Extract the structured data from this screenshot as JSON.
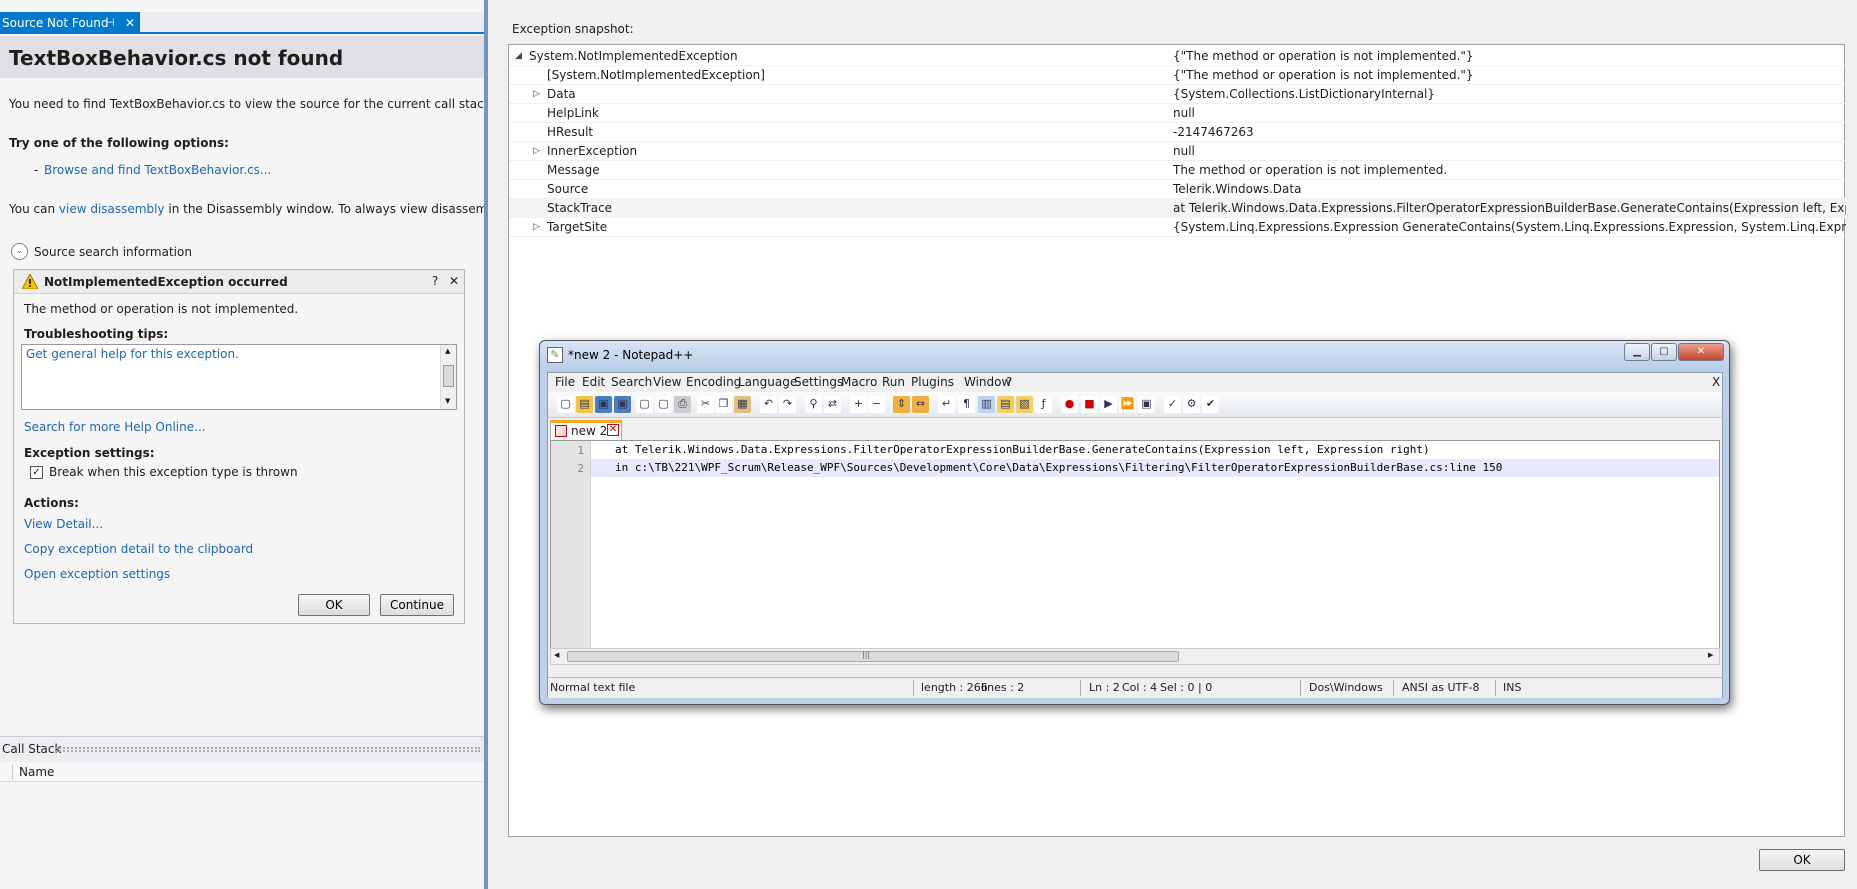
{
  "source_panel": {
    "tab_label": "Source Not Found",
    "pin_glyph": "⊣",
    "close_glyph": "✕",
    "title": "TextBoxBehavior.cs not found",
    "description": "You need to find TextBoxBehavior.cs to view the source for the current call stack frame",
    "options_heading": "Try one of the following options:",
    "option_bullet": "-",
    "option_link": "Browse and find TextBoxBehavior.cs...",
    "disasm_prefix": "You can",
    "disasm_link": "view disassembly",
    "disasm_suffix": "in the Disassembly window. To always view disassembly for mis",
    "source_search_label": "Source search information"
  },
  "exception_assistant": {
    "title": "NotImplementedException occurred",
    "help_glyph": "?",
    "close_glyph": "✕",
    "message": "The method or operation is not implemented.",
    "tips_heading": "Troubleshooting tips:",
    "tips_link": "Get general help for this exception.",
    "search_help_link": "Search for more Help Online...",
    "settings_heading": "Exception settings:",
    "break_checkbox_label": "Break when this exception type is thrown",
    "break_checked": true,
    "actions_heading": "Actions:",
    "view_detail_link": "View Detail...",
    "copy_detail_link": "Copy exception detail to the clipboard",
    "open_settings_link": "Open exception settings",
    "ok_label": "OK",
    "continue_label": "Continue"
  },
  "call_stack": {
    "title": "Call Stack",
    "name_column": "Name"
  },
  "exception_snapshot": {
    "heading": "Exception snapshot:",
    "rows": [
      {
        "name": "System.NotImplementedException",
        "value": "{\"The method or operation is not implemented.\"}",
        "expander": "expanded"
      },
      {
        "name": "[System.NotImplementedException]",
        "value": "{\"The method or operation is not implemented.\"}",
        "expander": "none"
      },
      {
        "name": "Data",
        "value": "{System.Collections.ListDictionaryInternal}",
        "expander": "collapsed"
      },
      {
        "name": "HelpLink",
        "value": "null",
        "expander": "none"
      },
      {
        "name": "HResult",
        "value": "-2147467263",
        "expander": "none"
      },
      {
        "name": "InnerException",
        "value": "null",
        "expander": "collapsed"
      },
      {
        "name": "Message",
        "value": "The method or operation is not implemented.",
        "expander": "none"
      },
      {
        "name": "Source",
        "value": "Telerik.Windows.Data",
        "expander": "none"
      },
      {
        "name": "StackTrace",
        "value": "  at Telerik.Windows.Data.Expressions.FilterOperatorExpressionBuilderBase.GenerateContains(Expression left, Expression right) in",
        "expander": "none"
      },
      {
        "name": "TargetSite",
        "value": "{System.Linq.Expressions.Expression GenerateContains(System.Linq.Expressions.Expression, System.Linq.Expressions.Expression)}",
        "expander": "collapsed"
      }
    ],
    "ok_label": "OK"
  },
  "notepadpp": {
    "window_title": "*new  2 - Notepad++",
    "menu": [
      "File",
      "Edit",
      "Search",
      "View",
      "Encoding",
      "Language",
      "Settings",
      "Macro",
      "Run",
      "Plugins",
      "Window",
      "?"
    ],
    "menu_close": "X",
    "tab_label": "new  2",
    "lines": [
      {
        "number": "1",
        "text": "at Telerik.Windows.Data.Expressions.FilterOperatorExpressionBuilderBase.GenerateContains(Expression left, Expression right)"
      },
      {
        "number": "2",
        "text": "in c:\\TB\\221\\WPF_Scrum\\Release_WPF\\Sources\\Development\\Core\\Data\\Expressions\\Filtering\\FilterOperatorExpressionBuilderBase.cs:line 150"
      }
    ],
    "status": {
      "file_type": "Normal text file",
      "length": "length : 266",
      "lines": "lines : 2",
      "ln": "Ln : 2",
      "col": "Col : 4",
      "sel": "Sel : 0 | 0",
      "eol": "Dos\\Windows",
      "encoding": "ANSI as UTF-8",
      "mode": "INS"
    },
    "window_buttons": {
      "minimize": "▁",
      "maximize": "▢",
      "close": "✕"
    },
    "scroll_grip": "|||"
  }
}
